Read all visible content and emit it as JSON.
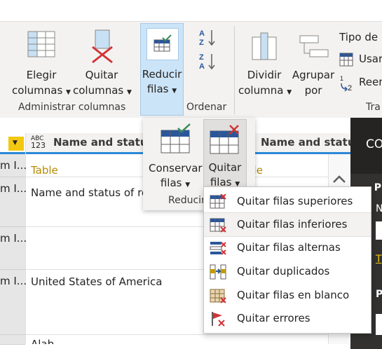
{
  "ribbon": {
    "choose_columns_l1": "Elegir",
    "choose_columns_l2": "columnas",
    "remove_columns_l1": "Quitar",
    "remove_columns_l2": "columnas",
    "reduce_rows_l1": "Reducir",
    "reduce_rows_l2": "filas",
    "manage_columns_group": "Administrar columnas",
    "sort_group": "Ordenar",
    "split_column_l1": "Dividir",
    "split_column_l2": "columna",
    "group_by_l1": "Agrupar",
    "group_by_l2": "por",
    "data_type": "Tipo de",
    "use_first": "Usar",
    "replace": "Reem",
    "transform_group": "Tra"
  },
  "popup": {
    "keep_rows_l1": "Conservar",
    "keep_rows_l2": "filas",
    "remove_rows_l1": "Quitar",
    "remove_rows_l2": "filas",
    "group_label": "Reducir"
  },
  "menu": {
    "items": [
      {
        "label": "Quitar filas superiores",
        "icon": "remove-top-rows-icon"
      },
      {
        "label": "Quitar filas inferiores",
        "icon": "remove-bottom-rows-icon"
      },
      {
        "label": "Quitar filas alternas",
        "icon": "remove-alternate-rows-icon"
      },
      {
        "label": "Quitar duplicados",
        "icon": "remove-duplicates-icon"
      },
      {
        "label": "Quitar filas en blanco",
        "icon": "remove-blank-rows-icon"
      },
      {
        "label": "Quitar errores",
        "icon": "remove-errors-icon"
      }
    ],
    "hovered_index": 1
  },
  "grid": {
    "col_type_abc": "ABC",
    "col_type_123": "123",
    "col1_header": "Name and status",
    "col2_header": "Name and status",
    "row_fragment": "m I...",
    "type_row_col1": "Table",
    "type_row_col2": "ble",
    "cell_r1": "Name and status of re",
    "cell_r3": "United States of America",
    "cell_r4": "Alab"
  },
  "right_pane": {
    "header": "CO",
    "mark_p": "P",
    "mark_n": "N",
    "mark_t": "T",
    "mark_p2": "P"
  },
  "colors": {
    "accent_blue": "#2b579a",
    "selected_tab": "#cce4f7",
    "remove_red": "#d13438",
    "header_yellow": "#f2c811"
  }
}
